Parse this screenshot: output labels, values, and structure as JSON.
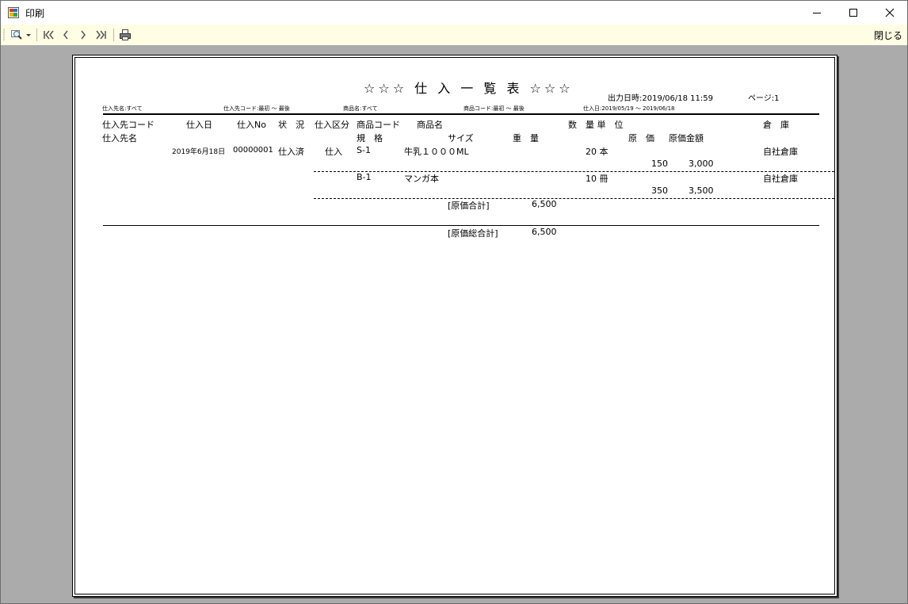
{
  "window": {
    "title": "印刷"
  },
  "toolbar": {
    "zoom_icon": "magnifier-icon",
    "first_icon": "first-page-icon",
    "prev_icon": "previous-page-icon",
    "next_icon": "next-page-icon",
    "last_icon": "last-page-icon",
    "print_icon": "printer-icon",
    "close_label": "閉じる"
  },
  "report": {
    "title": "☆☆☆ 仕 入 一 覧 表 ☆☆☆",
    "output_datetime": "出力日時:2019/06/18 11:59",
    "page_label": "ページ:1",
    "filters": {
      "supplier_name": "仕入先名:すべて",
      "supplier_code": "仕入先コード:最初 ～ 最後",
      "product_name": "商品名:すべて",
      "product_code": "商品コード:最初 ～ 最後",
      "purchase_date": "仕入日:2019/05/19 ～ 2019/06/18"
    },
    "headers": {
      "supplier_code": "仕入先コード",
      "purchase_date": "仕入日",
      "purchase_no": "仕入No",
      "status": "状　況",
      "purchase_type": "仕入区分",
      "product_code": "商品コード",
      "product_name": "商品名",
      "quantity_unit": "数　量 単　位",
      "warehouse": "倉　庫",
      "supplier_name": "仕入先名",
      "spec": "規　格",
      "size": "サイズ",
      "weight": "重　量",
      "cost": "原　価",
      "cost_amount": "原価金額"
    },
    "slip": {
      "date": "2019年6月18日",
      "no": "00000001",
      "status": "仕入済",
      "type": "仕入"
    },
    "lines": [
      {
        "code": "S-1",
        "name": "牛乳１０００ML",
        "qty_unit": "20 本",
        "warehouse": "自社倉庫",
        "cost": "150",
        "amount": "3,000"
      },
      {
        "code": "B-1",
        "name": "マンガ本",
        "qty_unit": "10 冊",
        "warehouse": "自社倉庫",
        "cost": "350",
        "amount": "3,500"
      }
    ],
    "subtotal_label": "[原価合計]",
    "subtotal_value": "6,500",
    "grand_total_label": "[原価総合計]",
    "grand_total_value": "6,500"
  }
}
